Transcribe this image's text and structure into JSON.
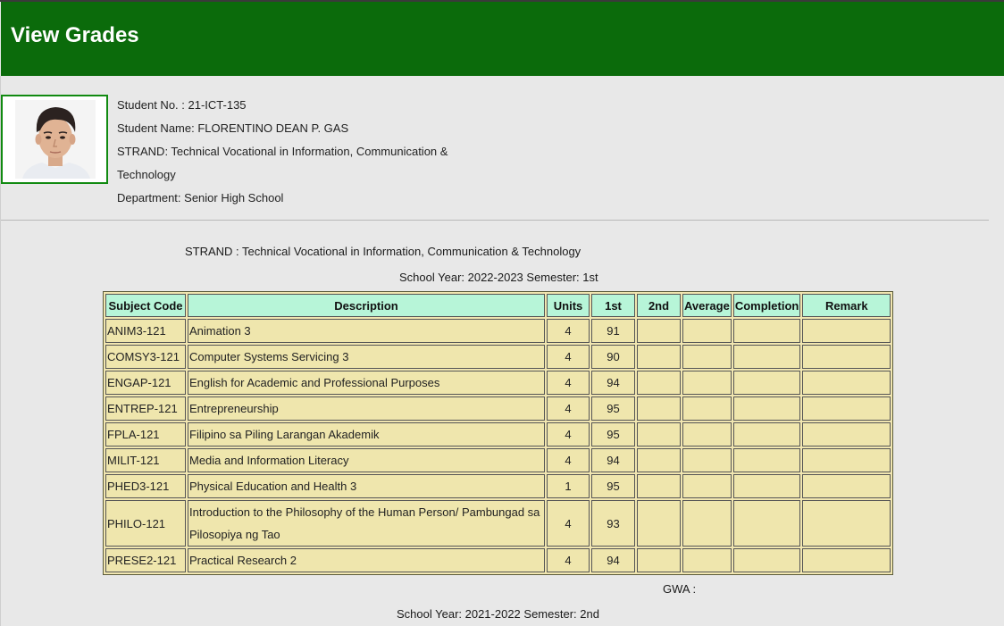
{
  "header": {
    "title": "View Grades"
  },
  "student": {
    "number_line": "Student No. : 21-ICT-135",
    "name_line": "Student Name: FLORENTINO DEAN P. GAS",
    "strand_line_1": "STRAND: Technical Vocational in Information, Communication &",
    "strand_line_2": "Technology",
    "department_line": "Department: Senior High School"
  },
  "strand_heading": "STRAND : Technical Vocational in Information, Communication & Technology",
  "semesters": [
    {
      "label": "School Year: 2022-2023 Semester: 1st"
    },
    {
      "label": "School Year: 2021-2022 Semester: 2nd"
    }
  ],
  "table": {
    "headers": [
      "Subject Code",
      "Description",
      "Units",
      "1st",
      "2nd",
      "Average",
      "Completion",
      "Remark"
    ],
    "rows": [
      {
        "code": "ANIM3-121",
        "description": "Animation 3",
        "units": "4",
        "first": "91",
        "second": "",
        "average": "",
        "completion": "",
        "remark": ""
      },
      {
        "code": "COMSY3-121",
        "description": "Computer Systems Servicing 3",
        "units": "4",
        "first": "90",
        "second": "",
        "average": "",
        "completion": "",
        "remark": ""
      },
      {
        "code": "ENGAP-121",
        "description": "English for Academic and Professional Purposes",
        "units": "4",
        "first": "94",
        "second": "",
        "average": "",
        "completion": "",
        "remark": ""
      },
      {
        "code": "ENTREP-121",
        "description": "Entrepreneurship",
        "units": "4",
        "first": "95",
        "second": "",
        "average": "",
        "completion": "",
        "remark": ""
      },
      {
        "code": "FPLA-121",
        "description": "Filipino sa Piling Larangan Akademik",
        "units": "4",
        "first": "95",
        "second": "",
        "average": "",
        "completion": "",
        "remark": ""
      },
      {
        "code": "MILIT-121",
        "description": "Media and Information Literacy",
        "units": "4",
        "first": "94",
        "second": "",
        "average": "",
        "completion": "",
        "remark": ""
      },
      {
        "code": "PHED3-121",
        "description": "Physical Education and Health 3",
        "units": "1",
        "first": "95",
        "second": "",
        "average": "",
        "completion": "",
        "remark": ""
      },
      {
        "code": "PHILO-121",
        "description": "Introduction to the Philosophy of the Human Person/ Pambungad sa Pilosopiya ng Tao",
        "units": "4",
        "first": "93",
        "second": "",
        "average": "",
        "completion": "",
        "remark": ""
      },
      {
        "code": "PRESE2-121",
        "description": "Practical Research 2",
        "units": "4",
        "first": "94",
        "second": "",
        "average": "",
        "completion": "",
        "remark": ""
      }
    ]
  },
  "gwa_label": "GWA :"
}
